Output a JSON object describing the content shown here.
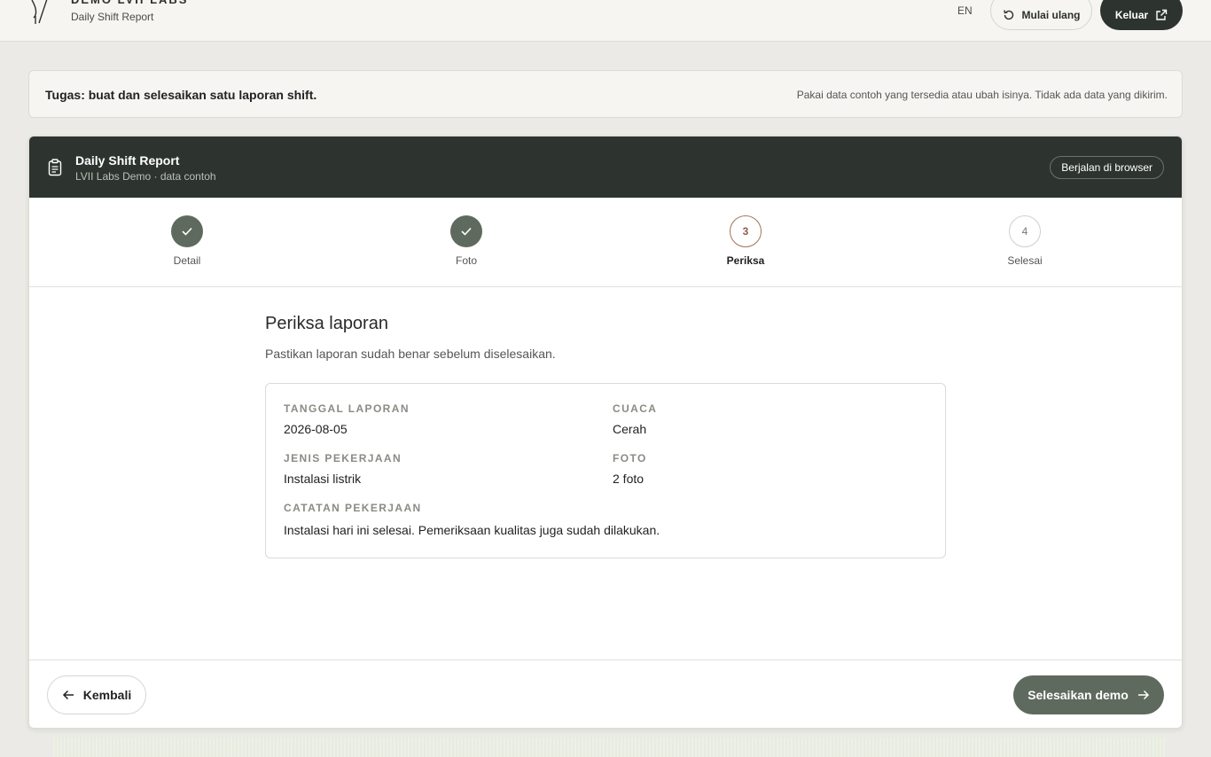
{
  "topbar": {
    "brand_name": "DEMO LVII LABS",
    "brand_sub": "Daily Shift Report",
    "lang": "EN",
    "restart_label": "Mulai ulang",
    "exit_label": "Keluar"
  },
  "task": {
    "title": "Tugas: buat dan selesaikan satu laporan shift.",
    "note": "Pakai data contoh yang tersedia atau ubah isinya. Tidak ada data yang dikirim."
  },
  "card": {
    "title": "Daily Shift Report",
    "subtitle": "LVII Labs Demo · data contoh",
    "badge": "Berjalan di browser"
  },
  "steps": [
    {
      "label": "Detail",
      "state": "done"
    },
    {
      "label": "Foto",
      "state": "done"
    },
    {
      "number": "3",
      "label": "Periksa",
      "state": "active"
    },
    {
      "number": "4",
      "label": "Selesai",
      "state": "todo"
    }
  ],
  "review": {
    "title": "Periksa laporan",
    "description": "Pastikan laporan sudah benar sebelum diselesaikan.",
    "fields": {
      "date_label": "TANGGAL LAPORAN",
      "date_value": "2026-08-05",
      "weather_label": "CUACA",
      "weather_value": "Cerah",
      "work_label": "JENIS PEKERJAAN",
      "work_value": "Instalasi listrik",
      "photo_label": "FOTO",
      "photo_value": "2 foto",
      "notes_label": "CATATAN PEKERJAAN",
      "notes_value": "Instalasi hari ini selesai. Pemeriksaan kualitas juga sudah dilakukan."
    }
  },
  "footer": {
    "back_label": "Kembali",
    "finish_label": "Selesaikan demo"
  },
  "colors": {
    "dark": "#2d3430",
    "accent": "#5e6a5d",
    "active_step": "#a2735a"
  }
}
